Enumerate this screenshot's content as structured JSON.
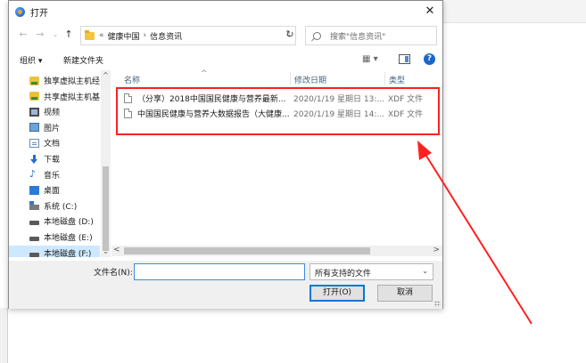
{
  "dialog": {
    "title": "打开",
    "close_glyph": "✕"
  },
  "address": {
    "overflow": "«",
    "sep": "›",
    "crumbs": [
      "健康中国",
      "信息资讯"
    ],
    "dropdown_glyph": "⌄",
    "refresh_glyph": "↻"
  },
  "nav": {
    "back": "←",
    "forward": "→",
    "recent": "⌄",
    "up": "↑"
  },
  "search": {
    "placeholder": "搜索\"信息资讯\""
  },
  "toolbar": {
    "organize": "组织 ▾",
    "new_folder": "新建文件夹",
    "view_glyph": "▦ ▾",
    "help": "?"
  },
  "sidebar": {
    "items": [
      {
        "label": "独享虚拟主机经",
        "icon": "server-icon"
      },
      {
        "label": "共享虚拟主机基",
        "icon": "server-icon"
      },
      {
        "label": "视频",
        "icon": "video-icon"
      },
      {
        "label": "图片",
        "icon": "pictures-icon"
      },
      {
        "label": "文档",
        "icon": "documents-icon"
      },
      {
        "label": "下载",
        "icon": "download-icon"
      },
      {
        "label": "音乐",
        "icon": "music-icon"
      },
      {
        "label": "桌面",
        "icon": "desktop-icon"
      },
      {
        "label": "系统 (C:)",
        "icon": "system-drive-icon"
      },
      {
        "label": "本地磁盘 (D:)",
        "icon": "drive-icon"
      },
      {
        "label": "本地磁盘 (E:)",
        "icon": "drive-icon"
      },
      {
        "label": "本地磁盘 (F:)",
        "icon": "drive-icon"
      }
    ],
    "selected_index": 11,
    "scroll_up": "^",
    "scroll_down": "⌄"
  },
  "columns": {
    "name": "名称",
    "date": "修改日期",
    "type": "类型",
    "sort_caret": "^"
  },
  "files": [
    {
      "name": "（分享）2018中国国民健康与营养最新...",
      "date": "2020/1/19 星期日 13:...",
      "type": "XDF 文件"
    },
    {
      "name": "中国国民健康与营养大数据报告（大健康...",
      "date": "2020/1/19 星期日 14:...",
      "type": "XDF 文件"
    }
  ],
  "hscroll": {
    "left": "<",
    "right": ">"
  },
  "bottom": {
    "filename_label": "文件名(N):",
    "filename_value": "",
    "filetype_value": "所有支持的文件",
    "filetype_caret": "⌄",
    "open_label": "打开(O)",
    "cancel_label": "取消"
  },
  "colors": {
    "annotation": "#ff2020",
    "accent": "#0078d7",
    "selection": "#cde8ff"
  }
}
